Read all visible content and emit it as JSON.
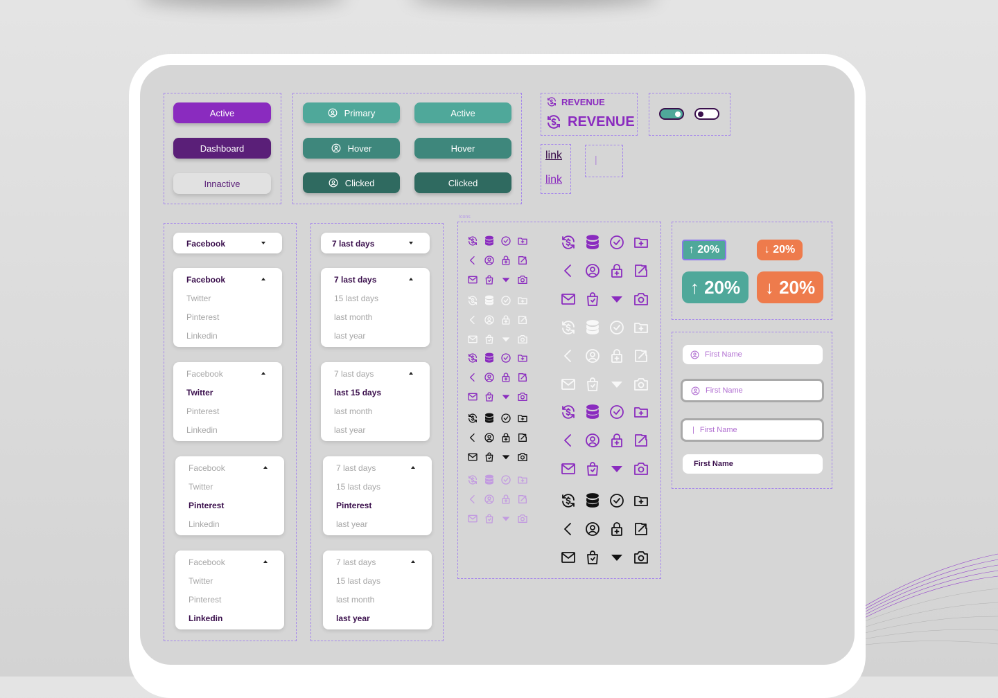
{
  "buttons_primary": {
    "active": "Active",
    "dashboard": "Dashboard",
    "inactive": "Innactive"
  },
  "buttons_teal": {
    "primary": "Primary",
    "hover": "Hover",
    "clicked": "Clicked",
    "active": "Active",
    "hover2": "Hover",
    "clicked2": "Clicked"
  },
  "revenue": {
    "small": "REVENUE",
    "large": "REVENUE"
  },
  "links": {
    "link1": "link",
    "link2": "link"
  },
  "cursor_box": {
    "text": "|"
  },
  "social_dropdowns": {
    "closed_label": "Facebook",
    "options": [
      "Facebook",
      "Twitter",
      "Pinterest",
      "Linkedin"
    ],
    "open1": {
      "options": [
        "Facebook",
        "Twitter",
        "Pinterest",
        "Linkedin"
      ],
      "selected": 0
    },
    "open2": {
      "options": [
        "Facebook",
        "Twitter",
        "Pinterest",
        "Linkedin"
      ],
      "selected": 1
    },
    "open3": {
      "options": [
        "Facebook",
        "Twitter",
        "Pinterest",
        "Linkedin"
      ],
      "selected": 2
    },
    "open4": {
      "options": [
        "Facebook",
        "Twitter",
        "Pinterest",
        "Linkedin"
      ],
      "selected": 3
    }
  },
  "date_dropdowns": {
    "closed_label": "7 last days",
    "open1": {
      "options": [
        "7 last days",
        "15 last days",
        "last month",
        "last year"
      ],
      "selected": 0
    },
    "open2": {
      "options": [
        "7 last days",
        "last 15 days",
        "last month",
        "last year"
      ],
      "selected": 1
    },
    "open3": {
      "options": [
        "7 last days",
        "15 last days",
        "Pinterest",
        "last year"
      ],
      "selected": 2
    },
    "open4": {
      "options": [
        "7 last days",
        "15 last days",
        "last month",
        "last year"
      ],
      "selected": 3
    }
  },
  "icons_section_label": "Icons",
  "icon_names": [
    "currency-exchange-icon",
    "database-icon",
    "check-circle-icon",
    "folder-add-icon",
    "chevron-left-icon",
    "user-circle-icon",
    "lock-icon",
    "external-link-icon",
    "mail-icon",
    "shopping-bag-icon",
    "caret-down-icon",
    "camera-icon"
  ],
  "badges": {
    "up_small": "↑ 20%",
    "down_small": "↓ 20%",
    "up_large": "↑ 20%",
    "down_large": "↓ 20%"
  },
  "inputs": {
    "placeholder1": "First Name",
    "placeholder2": "First Name",
    "placeholder3": "First Name",
    "value4": "First Name"
  },
  "colors": {
    "purple": "#8a2bbf",
    "purple_dark": "#5a1f78",
    "teal": "#4fa89a",
    "teal_hover": "#3e877c",
    "teal_clicked": "#2f6a60",
    "orange": "#ee7b4c",
    "dash": "#a585ec"
  }
}
